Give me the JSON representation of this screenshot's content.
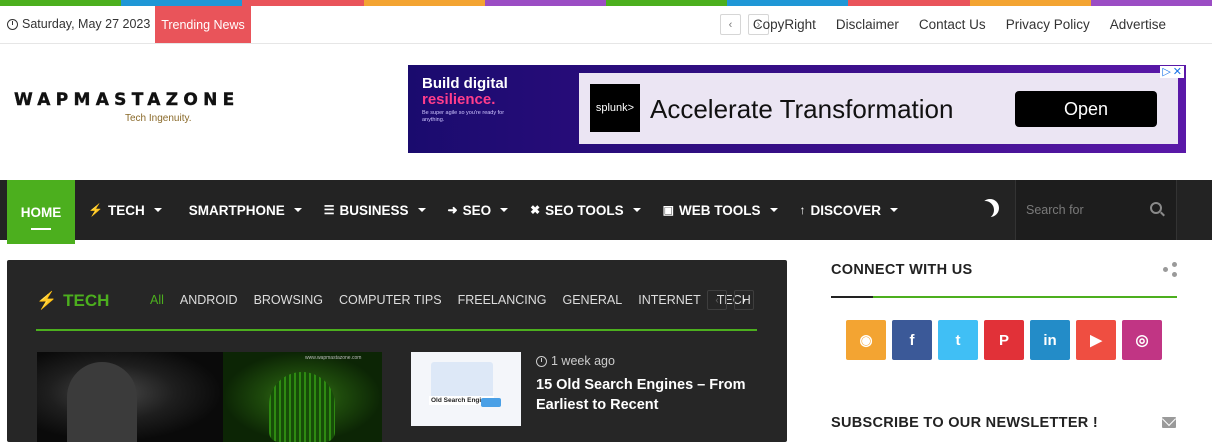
{
  "colors": {
    "accent": "#4caf1e",
    "trending": "#e9545a",
    "rainbow": [
      "#4caf1e",
      "#1f97d6",
      "#e9545a",
      "#f3a432",
      "#9b4dc4",
      "#4caf1e",
      "#1f97d6",
      "#e9545a",
      "#f3a432",
      "#9b4dc4"
    ]
  },
  "topbar": {
    "date": "Saturday, May 27 2023",
    "trending_label": "Trending News",
    "prev_icon": "‹",
    "next_icon": "›",
    "links": [
      "CopyRight",
      "Disclaimer",
      "Contact Us",
      "Privacy Policy",
      "Advertise"
    ]
  },
  "logo": {
    "name": "WAPMASTAZONE",
    "tagline": "Tech Ingenuity."
  },
  "ad": {
    "headline_1": "Build digital",
    "headline_2": "resilience.",
    "small_print": "Be super agile so you're ready for anything.",
    "brand": "splunk>",
    "title": "Accelerate Transformation",
    "cta": "Open",
    "adchoices": "▷",
    "close": "✕"
  },
  "nav": {
    "home": "HOME",
    "items": [
      {
        "icon": "bolt-icon",
        "glyph": "⚡",
        "label": "TECH"
      },
      {
        "icon": "apple-icon",
        "glyph": "",
        "label": "SMARTPHONE"
      },
      {
        "icon": "list-icon",
        "glyph": "☰",
        "label": "BUSINESS"
      },
      {
        "icon": "arrow-circle-icon",
        "glyph": "➜",
        "label": "SEO"
      },
      {
        "icon": "tools-icon",
        "glyph": "✖",
        "label": "SEO TOOLS"
      },
      {
        "icon": "monitor-icon",
        "glyph": "▣",
        "label": "WEB TOOLS"
      },
      {
        "icon": "arrow-up-icon",
        "glyph": "↑",
        "label": "DISCOVER"
      }
    ],
    "search_placeholder": "Search for"
  },
  "tech_block": {
    "title": "TECH",
    "title_glyph": "⚡",
    "tabs": [
      "All",
      "ANDROID",
      "BROWSING",
      "COMPUTER TIPS",
      "FREELANCING",
      "GENERAL",
      "INTERNET",
      "TECH"
    ],
    "prev": "‹",
    "next": "›",
    "circuit_caption": "www.wapmastazone.com",
    "thumb_caption": "Old Search Engines",
    "post": {
      "time": "1 week ago",
      "title": "15 Old Search Engines – From Earliest to Recent"
    }
  },
  "sidebar": {
    "connect_title": "CONNECT WITH US",
    "subscribe_title": "SUBSCRIBE TO OUR NEWSLETTER !",
    "socials": [
      {
        "name": "rss",
        "glyph": "◉",
        "color": "#f3a432"
      },
      {
        "name": "facebook",
        "glyph": "f",
        "color": "#3b5998"
      },
      {
        "name": "twitter",
        "glyph": "t",
        "color": "#40bff5"
      },
      {
        "name": "pinterest",
        "glyph": "P",
        "color": "#e13138"
      },
      {
        "name": "linkedin",
        "glyph": "in",
        "color": "#238cc8"
      },
      {
        "name": "youtube",
        "glyph": "▶",
        "color": "#ef4e41"
      },
      {
        "name": "instagram",
        "glyph": "◎",
        "color": "#c13584"
      }
    ]
  }
}
